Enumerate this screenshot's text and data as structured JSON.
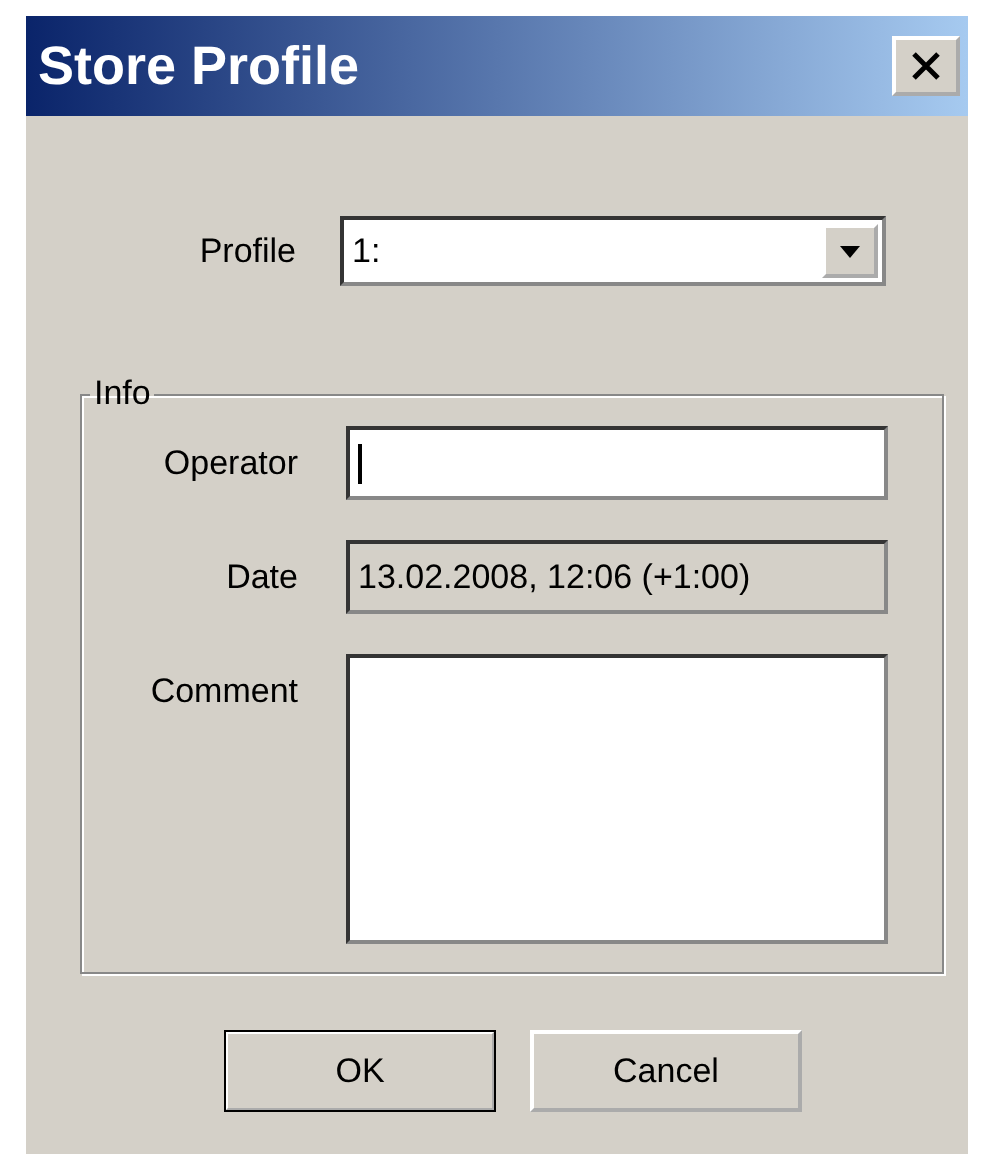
{
  "window": {
    "title": "Store Profile"
  },
  "profile": {
    "label": "Profile",
    "value": "1:"
  },
  "info": {
    "legend": "Info",
    "fields": [
      {
        "kind": "input",
        "label": "Operator",
        "focused": true,
        "disabled": false
      },
      {
        "kind": "input",
        "label": "Date",
        "value": "13.02.2008, 12:06 (+1:00)",
        "focused": false,
        "disabled": true
      },
      {
        "kind": "textarea",
        "label": "Comment",
        "focused": false,
        "disabled": false
      }
    ]
  },
  "buttons": [
    {
      "label": "OK",
      "default": true
    },
    {
      "label": "Cancel",
      "default": false
    }
  ]
}
